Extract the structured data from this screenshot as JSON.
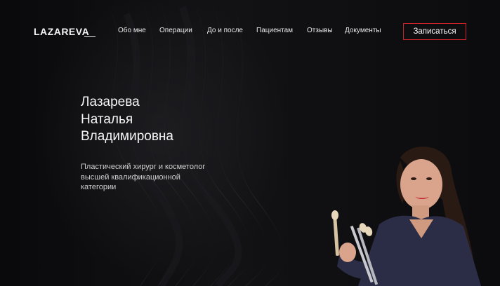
{
  "header": {
    "logo": "LAZAREVA",
    "nav": [
      {
        "label": "Обо мне"
      },
      {
        "label": "Операции"
      },
      {
        "label": "До и после"
      },
      {
        "label": "Пациентам"
      },
      {
        "label": "Отзывы"
      },
      {
        "label": "Документы"
      }
    ],
    "cta_label": "Записаться"
  },
  "hero": {
    "name_lines": [
      "Лазарева",
      "Наталья",
      "Владимировна"
    ],
    "subtitle_lines": [
      "Пластический хирург и косметолог",
      "высшей квалификационной",
      "категории"
    ]
  },
  "colors": {
    "background": "#0d0d0f",
    "accent": "#c8242a",
    "text": "#ffffff"
  }
}
